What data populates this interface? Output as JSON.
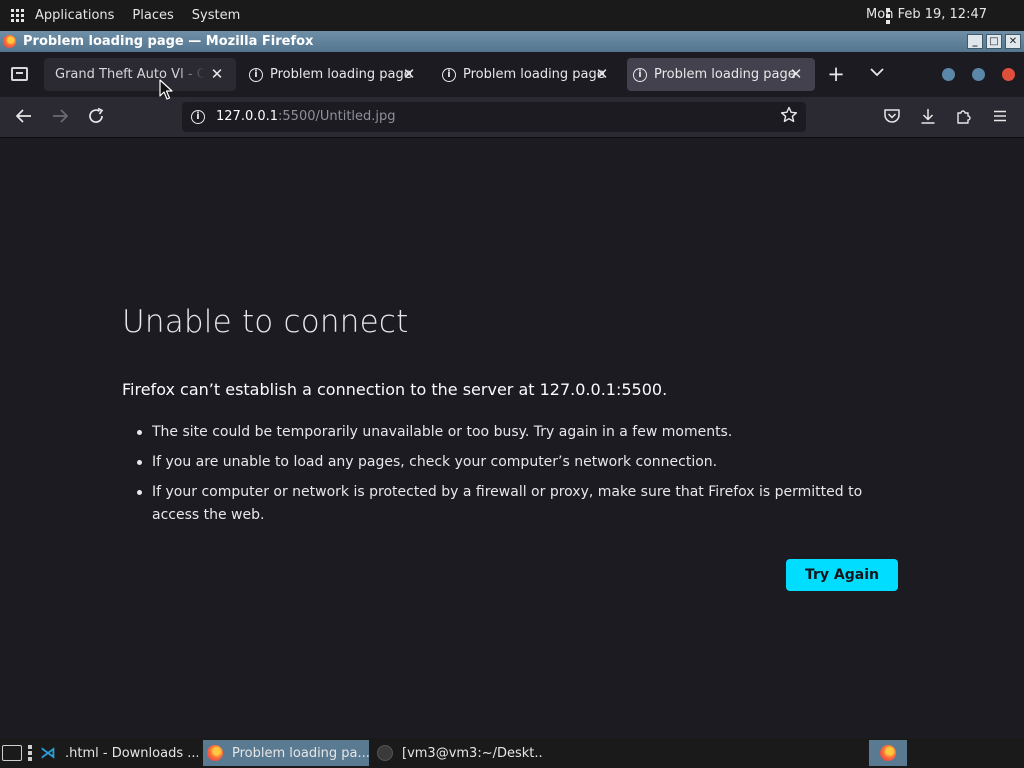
{
  "system_panel": {
    "menus": [
      "Applications",
      "Places",
      "System"
    ],
    "clock": "Mon Feb 19, 12:47"
  },
  "window": {
    "title": "Problem loading page — Mozilla Firefox",
    "buttons": [
      "_",
      "□",
      "✕"
    ]
  },
  "tabs": [
    {
      "title": "Grand Theft Auto VI - Online"
    },
    {
      "title": "Problem loading page"
    },
    {
      "title": "Problem loading page"
    },
    {
      "title": "Problem loading page",
      "active": true
    }
  ],
  "toolbar": {
    "url_host": "127.0.0.1",
    "url_rest": ":5500/Untitled.jpg"
  },
  "page": {
    "heading": "Unable to connect",
    "lead": "Firefox can’t establish a connection to the server at 127.0.0.1:5500.",
    "bullets": [
      "The site could be temporarily unavailable or too busy. Try again in a few moments.",
      "If you are unable to load any pages, check your computer’s network connection.",
      "If your computer or network is protected by a firewall or proxy, make sure that Firefox is permitted to access the web."
    ],
    "try_again_label": "Try Again"
  },
  "taskbar": {
    "tasks": [
      {
        "label": ".html - Downloads ..."
      },
      {
        "label": "Problem loading pa..."
      },
      {
        "label": "[vm3@vm3:~/Deskt..."
      }
    ]
  },
  "colors": {
    "accent_button": "#00ddff",
    "page_bg": "#1c1b22",
    "titlebar": "#55768f"
  },
  "icons": {
    "tab_list": "tab-list-icon",
    "tab_info": "info-icon",
    "back": "arrow-left-icon",
    "forward": "arrow-right-icon",
    "reload": "reload-icon",
    "bookmark": "star-icon",
    "pocket": "pocket-icon",
    "downloads": "download-icon",
    "extensions": "puzzle-icon",
    "menu": "hamburger-icon"
  }
}
